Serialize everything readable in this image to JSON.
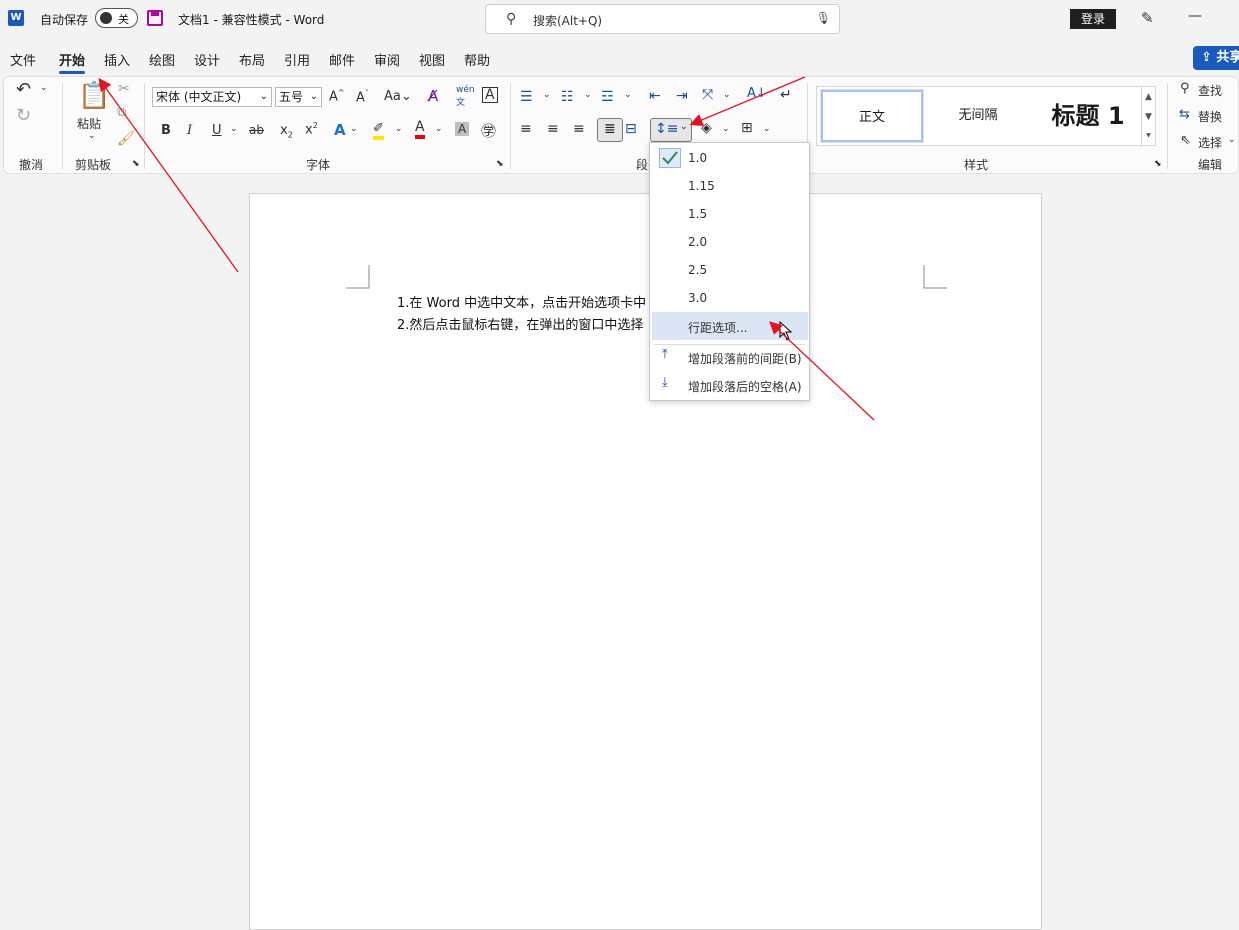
{
  "titlebar": {
    "app_icon": "word-logo-icon",
    "autosave_label": "自动保存",
    "autosave_state": "关",
    "doc_title": "文档1  -  兼容性模式  -  Word",
    "search_placeholder": "搜索(Alt+Q)",
    "login_label": "登录",
    "share_label": "共享"
  },
  "tabs": [
    "文件",
    "开始",
    "插入",
    "绘图",
    "设计",
    "布局",
    "引用",
    "邮件",
    "审阅",
    "视图",
    "帮助"
  ],
  "ribbon": {
    "undo_group": "撤消",
    "clipboard_group": "剪贴板",
    "paste_label": "粘贴",
    "font_group": "字体",
    "font_name": "宋体 (中文正文)",
    "font_size": "五号",
    "paragraph_group": "段落",
    "styles_group": "样式",
    "styles": [
      "正文",
      "无间隔",
      "标题 1"
    ],
    "editing_group": "编辑",
    "find_label": "查找",
    "replace_label": "替换",
    "select_label": "选择"
  },
  "document": {
    "line1": "1.在 Word 中选中文本，点击开始选项卡中",
    "line2": "2.然后点击鼠标右键，在弹出的窗口中选择"
  },
  "line_spacing_menu": {
    "options": [
      "1.0",
      "1.15",
      "1.5",
      "2.0",
      "2.5",
      "3.0"
    ],
    "selected": "1.0",
    "more_options": "行距选项...",
    "add_before": "增加段落前的间距(B)",
    "add_after": "增加段落后的空格(A)"
  },
  "colors": {
    "accent": "#185abd",
    "annotation_arrow": "#e81123"
  }
}
